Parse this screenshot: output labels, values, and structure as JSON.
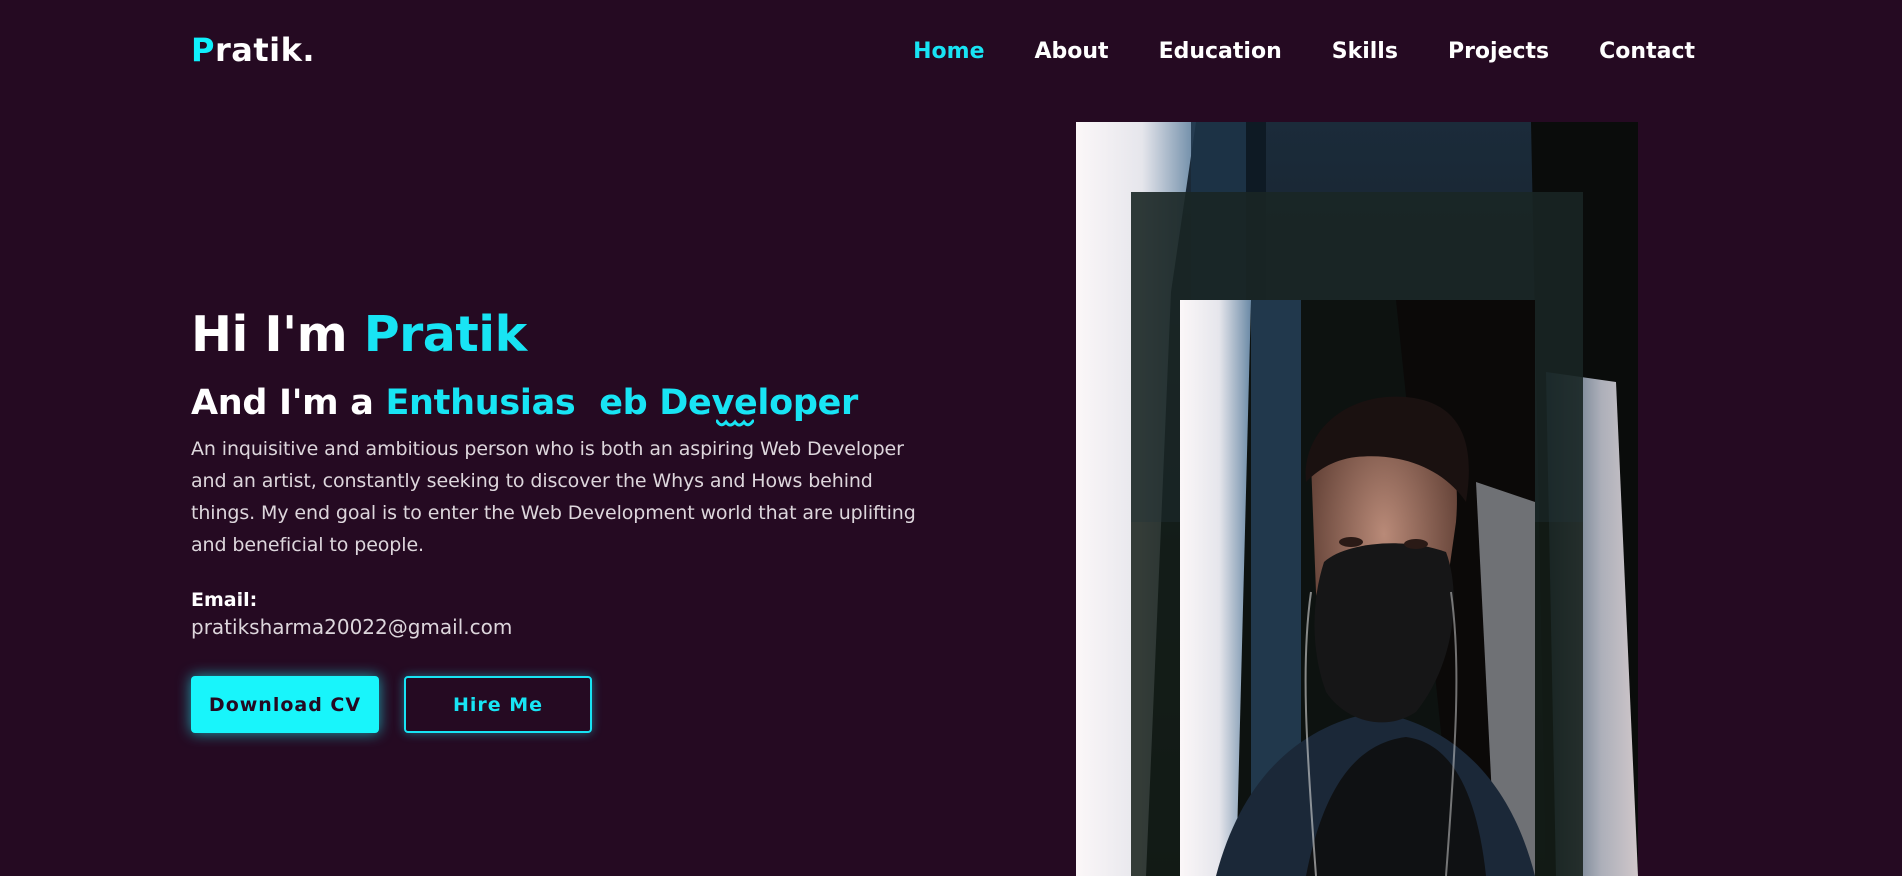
{
  "logo": {
    "accent": "P",
    "rest": "ratik."
  },
  "nav": {
    "items": [
      {
        "label": "Home",
        "active": true
      },
      {
        "label": "About"
      },
      {
        "label": "Education"
      },
      {
        "label": "Skills"
      },
      {
        "label": "Projects"
      },
      {
        "label": "Contact"
      }
    ]
  },
  "hero": {
    "greeting": "Hi I'm ",
    "name": "Pratik",
    "sub_prefix": "And I'm a ",
    "sub_accent": "Enthusias  eb Developer",
    "description": "An inquisitive and ambitious person who is both an aspiring Web Developer and an artist, constantly seeking to discover the Whys and Hows behind things. My end goal is to enter the Web Development world that are uplifting and beneficial to people.",
    "email_label": "Email:",
    "email": "pratiksharma20022@gmail.com",
    "buttons": {
      "download": "Download CV",
      "hire": "Hire Me"
    }
  },
  "colors": {
    "background": "#250a22",
    "accent": "#18e4f4",
    "button_fill": "#18f5fb"
  }
}
